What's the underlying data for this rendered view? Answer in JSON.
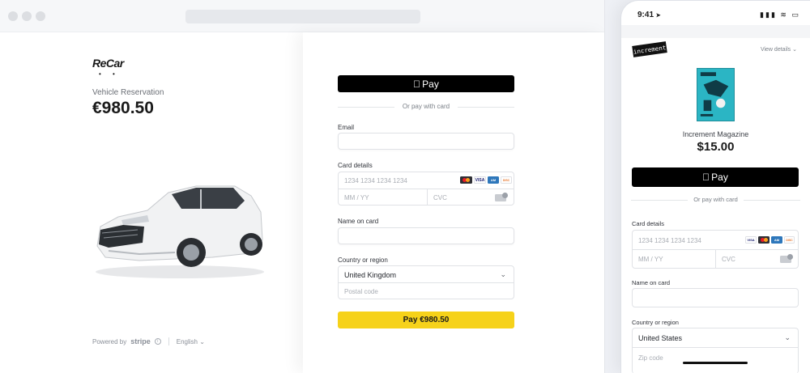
{
  "desktop": {
    "merchant": {
      "logo_text": "ReCar",
      "logo_dots": "• •",
      "product_label": "Vehicle Reservation",
      "price": "€980.50"
    },
    "footer": {
      "powered_by": "Powered by",
      "stripe": "stripe",
      "language": "English"
    },
    "form": {
      "applepay_label": "Pay",
      "or_pay_with_card": "Or pay with card",
      "email_label": "Email",
      "email_value": "",
      "card_label": "Card details",
      "card_number_placeholder": "1234 1234 1234 1234",
      "expiry_placeholder": "MM / YY",
      "cvc_placeholder": "CVC",
      "name_label": "Name on card",
      "name_value": "",
      "country_label": "Country or region",
      "country_value": "United Kingdom",
      "postal_placeholder": "Postal code",
      "pay_button": "Pay €980.50"
    },
    "colors": {
      "accent": "#f6d21a",
      "applepay": "#000000"
    }
  },
  "mobile": {
    "status": {
      "time": "9:41",
      "icons": "▮▮▮ ≋ ▭"
    },
    "brand_logo": "increment",
    "view_details": "View details",
    "product_name": "Increment Magazine",
    "price": "$15.00",
    "applepay_label": "Pay",
    "or_pay_with_card": "Or pay with card",
    "card_label": "Card details",
    "card_number_placeholder": "1234 1234 1234 1234",
    "expiry_placeholder": "MM / YY",
    "cvc_placeholder": "CVC",
    "name_label": "Name on card",
    "country_label": "Country or region",
    "country_value": "United States",
    "zip_placeholder": "Zip code"
  },
  "card_brands": [
    "MC",
    "VISA",
    "AMEX",
    "DISC"
  ]
}
